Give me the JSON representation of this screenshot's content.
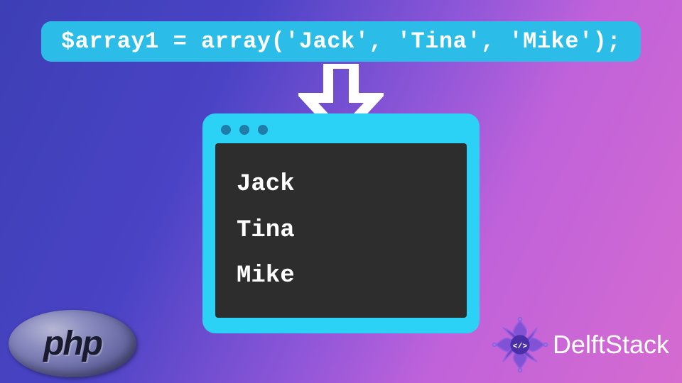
{
  "code_banner": "$array1 = array('Jack', 'Tina', 'Mike');",
  "arrow": {
    "name": "down-arrow"
  },
  "console": {
    "dot_count": 3,
    "output": [
      "Jack",
      "Tina",
      "Mike"
    ]
  },
  "php_badge": {
    "text": "php"
  },
  "delftstack": {
    "icon_glyph": "</>",
    "label": "DelftStack"
  },
  "colors": {
    "banner_bg": "#2bbde8",
    "console_frame": "#2bd2f5",
    "console_body": "#2d2d2d",
    "dot": "#1f7da8"
  }
}
